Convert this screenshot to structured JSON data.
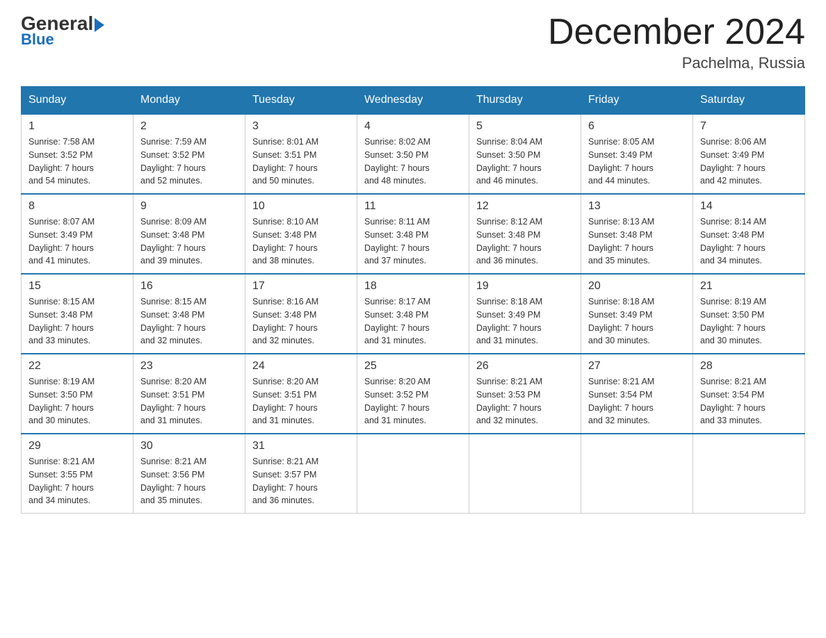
{
  "header": {
    "logo_line1": "General",
    "logo_line2": "Blue",
    "month": "December 2024",
    "location": "Pachelma, Russia"
  },
  "weekdays": [
    "Sunday",
    "Monday",
    "Tuesday",
    "Wednesday",
    "Thursday",
    "Friday",
    "Saturday"
  ],
  "weeks": [
    [
      {
        "day": "1",
        "sunrise": "7:58 AM",
        "sunset": "3:52 PM",
        "daylight": "7 hours and 54 minutes."
      },
      {
        "day": "2",
        "sunrise": "7:59 AM",
        "sunset": "3:52 PM",
        "daylight": "7 hours and 52 minutes."
      },
      {
        "day": "3",
        "sunrise": "8:01 AM",
        "sunset": "3:51 PM",
        "daylight": "7 hours and 50 minutes."
      },
      {
        "day": "4",
        "sunrise": "8:02 AM",
        "sunset": "3:50 PM",
        "daylight": "7 hours and 48 minutes."
      },
      {
        "day": "5",
        "sunrise": "8:04 AM",
        "sunset": "3:50 PM",
        "daylight": "7 hours and 46 minutes."
      },
      {
        "day": "6",
        "sunrise": "8:05 AM",
        "sunset": "3:49 PM",
        "daylight": "7 hours and 44 minutes."
      },
      {
        "day": "7",
        "sunrise": "8:06 AM",
        "sunset": "3:49 PM",
        "daylight": "7 hours and 42 minutes."
      }
    ],
    [
      {
        "day": "8",
        "sunrise": "8:07 AM",
        "sunset": "3:49 PM",
        "daylight": "7 hours and 41 minutes."
      },
      {
        "day": "9",
        "sunrise": "8:09 AM",
        "sunset": "3:48 PM",
        "daylight": "7 hours and 39 minutes."
      },
      {
        "day": "10",
        "sunrise": "8:10 AM",
        "sunset": "3:48 PM",
        "daylight": "7 hours and 38 minutes."
      },
      {
        "day": "11",
        "sunrise": "8:11 AM",
        "sunset": "3:48 PM",
        "daylight": "7 hours and 37 minutes."
      },
      {
        "day": "12",
        "sunrise": "8:12 AM",
        "sunset": "3:48 PM",
        "daylight": "7 hours and 36 minutes."
      },
      {
        "day": "13",
        "sunrise": "8:13 AM",
        "sunset": "3:48 PM",
        "daylight": "7 hours and 35 minutes."
      },
      {
        "day": "14",
        "sunrise": "8:14 AM",
        "sunset": "3:48 PM",
        "daylight": "7 hours and 34 minutes."
      }
    ],
    [
      {
        "day": "15",
        "sunrise": "8:15 AM",
        "sunset": "3:48 PM",
        "daylight": "7 hours and 33 minutes."
      },
      {
        "day": "16",
        "sunrise": "8:15 AM",
        "sunset": "3:48 PM",
        "daylight": "7 hours and 32 minutes."
      },
      {
        "day": "17",
        "sunrise": "8:16 AM",
        "sunset": "3:48 PM",
        "daylight": "7 hours and 32 minutes."
      },
      {
        "day": "18",
        "sunrise": "8:17 AM",
        "sunset": "3:48 PM",
        "daylight": "7 hours and 31 minutes."
      },
      {
        "day": "19",
        "sunrise": "8:18 AM",
        "sunset": "3:49 PM",
        "daylight": "7 hours and 31 minutes."
      },
      {
        "day": "20",
        "sunrise": "8:18 AM",
        "sunset": "3:49 PM",
        "daylight": "7 hours and 30 minutes."
      },
      {
        "day": "21",
        "sunrise": "8:19 AM",
        "sunset": "3:50 PM",
        "daylight": "7 hours and 30 minutes."
      }
    ],
    [
      {
        "day": "22",
        "sunrise": "8:19 AM",
        "sunset": "3:50 PM",
        "daylight": "7 hours and 30 minutes."
      },
      {
        "day": "23",
        "sunrise": "8:20 AM",
        "sunset": "3:51 PM",
        "daylight": "7 hours and 31 minutes."
      },
      {
        "day": "24",
        "sunrise": "8:20 AM",
        "sunset": "3:51 PM",
        "daylight": "7 hours and 31 minutes."
      },
      {
        "day": "25",
        "sunrise": "8:20 AM",
        "sunset": "3:52 PM",
        "daylight": "7 hours and 31 minutes."
      },
      {
        "day": "26",
        "sunrise": "8:21 AM",
        "sunset": "3:53 PM",
        "daylight": "7 hours and 32 minutes."
      },
      {
        "day": "27",
        "sunrise": "8:21 AM",
        "sunset": "3:54 PM",
        "daylight": "7 hours and 32 minutes."
      },
      {
        "day": "28",
        "sunrise": "8:21 AM",
        "sunset": "3:54 PM",
        "daylight": "7 hours and 33 minutes."
      }
    ],
    [
      {
        "day": "29",
        "sunrise": "8:21 AM",
        "sunset": "3:55 PM",
        "daylight": "7 hours and 34 minutes."
      },
      {
        "day": "30",
        "sunrise": "8:21 AM",
        "sunset": "3:56 PM",
        "daylight": "7 hours and 35 minutes."
      },
      {
        "day": "31",
        "sunrise": "8:21 AM",
        "sunset": "3:57 PM",
        "daylight": "7 hours and 36 minutes."
      },
      null,
      null,
      null,
      null
    ]
  ],
  "labels": {
    "sunrise": "Sunrise:",
    "sunset": "Sunset:",
    "daylight": "Daylight:"
  }
}
